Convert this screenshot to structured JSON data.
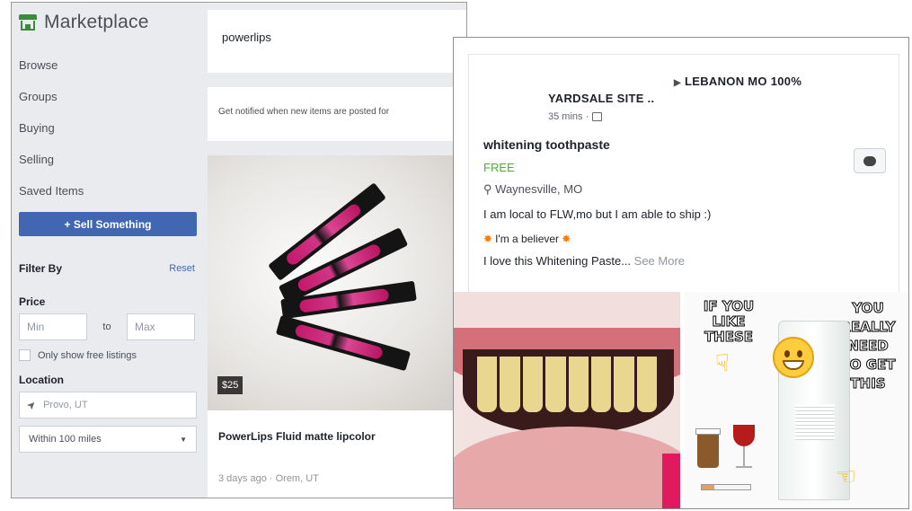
{
  "marketplace": {
    "title": "Marketplace",
    "nav": [
      "Browse",
      "Groups",
      "Buying",
      "Selling",
      "Saved Items"
    ],
    "sell_button": "+ Sell Something",
    "filter": {
      "title": "Filter By",
      "reset": "Reset",
      "price_label": "Price",
      "min_placeholder": "Min",
      "to_label": "to",
      "max_placeholder": "Max",
      "free_only": "Only show free listings",
      "location_label": "Location",
      "location_value": "Provo, UT",
      "radius_value": "Within 100 miles"
    },
    "search_value": "powerlips",
    "notify_text": "Get notified when new items are posted for",
    "listing": {
      "price": "$25",
      "title": "PowerLips Fluid matte lipcolor",
      "meta": "3 days ago · Orem, UT"
    }
  },
  "post": {
    "group": "LEBANON MO 100%",
    "group_sub": "YARDSALE SITE ..",
    "time": "35 mins ·",
    "title": "whitening toothpaste",
    "price": "FREE",
    "location": "Waynesville, MO",
    "body_line1": "I am local to FLW,mo but I am able to ship :)",
    "body_line2": "I'm a believer",
    "body_line3": "I love this Whitening Paste...",
    "see_more": "See More",
    "meme_left": [
      "IF YOU",
      "LIKE THESE"
    ],
    "meme_right": [
      "YOU",
      "REALLY",
      "NEED",
      "TO GET",
      "THIS"
    ]
  }
}
